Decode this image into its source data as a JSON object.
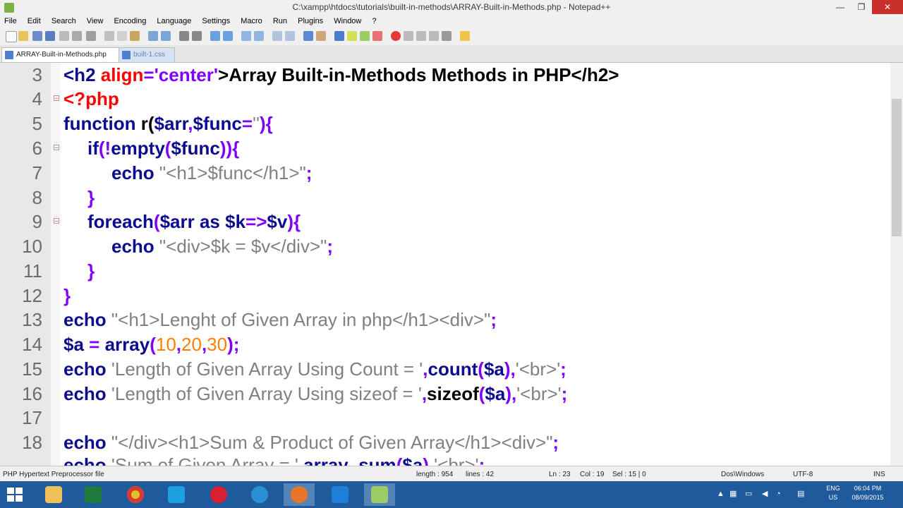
{
  "window": {
    "title": "C:\\xampp\\htdocs\\tutorials\\built-in-methods\\ARRAY-Built-in-Methods.php - Notepad++",
    "minimize": "—",
    "maximize": "❐",
    "close": "✕"
  },
  "menu": [
    "File",
    "Edit",
    "Search",
    "View",
    "Encoding",
    "Language",
    "Settings",
    "Macro",
    "Run",
    "Plugins",
    "Window",
    "?"
  ],
  "tabs": [
    {
      "label": "ARRAY-Built-in-Methods.php",
      "active": true,
      "close": "✕"
    },
    {
      "label": "built-1.css",
      "active": false,
      "close": "✕"
    }
  ],
  "editor": {
    "lines": [
      {
        "num": "3"
      },
      {
        "num": "4"
      },
      {
        "num": "5"
      },
      {
        "num": "6"
      },
      {
        "num": "7"
      },
      {
        "num": "8"
      },
      {
        "num": "9"
      },
      {
        "num": "10"
      },
      {
        "num": "11"
      },
      {
        "num": "12"
      },
      {
        "num": "13"
      },
      {
        "num": "14"
      },
      {
        "num": "15"
      },
      {
        "num": "16"
      },
      {
        "num": "17"
      },
      {
        "num": "18"
      }
    ],
    "code": {
      "l3": {
        "a": "<h2 ",
        "b": "align",
        "c": "=",
        "d": "'center'",
        "e": ">Array Built-in-Methods Methods in PHP</h2>"
      },
      "l4": {
        "a": "<?php"
      },
      "l5": {
        "a": "function ",
        "b": "r(",
        "c": "$arr",
        "d": ",",
        "e": "$func",
        "f": "=",
        "g": "''",
        "h": "){"
      },
      "l6": {
        "a": "if",
        "b": "(!",
        "c": "empty",
        "d": "(",
        "e": "$func",
        "f": ")){"
      },
      "l7": {
        "a": "echo ",
        "b": "\"<h1>$func</h1>\"",
        "c": ";"
      },
      "l8": {
        "a": "}"
      },
      "l9": {
        "a": "foreach",
        "b": "(",
        "c": "$arr",
        "d": " as ",
        "e": "$k",
        "f": "=>",
        "g": "$v",
        "h": "){"
      },
      "l10": {
        "a": "echo ",
        "b": "\"<div>$k = $v</div>\"",
        "c": ";"
      },
      "l11": {
        "a": "}"
      },
      "l12": {
        "a": "}"
      },
      "l13": {
        "a": "echo ",
        "b": "\"<h1>Lenght of Given Array in php</h1><div>\"",
        "c": ";"
      },
      "l14": {
        "a": "$a",
        "b": " = ",
        "c": "array",
        "d": "(",
        "e": "10",
        "f": ",",
        "g": "20",
        "h": ",",
        "i": "30",
        "j": ");"
      },
      "l15": {
        "a": "echo ",
        "b": "'Length of Given Array Using Count = '",
        "c": ",",
        "d": "count",
        "e": "(",
        "f": "$a",
        "g": "),",
        "h": "'<br>'",
        "i": ";"
      },
      "l16": {
        "a": "echo ",
        "b": "'Length of Given Array Using sizeof = '",
        "c": ",",
        "d": "sizeof",
        "e": "(",
        "f": "$a",
        "g": "),",
        "h": "'<br>'",
        "i": ";"
      },
      "l18": {
        "a": "echo ",
        "b": "\"</div><h1>Sum & Product of Given Array</h1><div>\"",
        "c": ";"
      },
      "l19": {
        "a": "echo ",
        "b": "'Sum of Given Array = '",
        "c": ",",
        "d": "array_sum",
        "e": "(",
        "f": "$a",
        "g": "),",
        "h": "'<br>'",
        "i": ";"
      }
    }
  },
  "status": {
    "filetype": "PHP Hypertext Preprocessor file",
    "length": "length : 954",
    "lines": "lines : 42",
    "ln": "Ln : 23",
    "col": "Col : 19",
    "sel": "Sel : 15 | 0",
    "eol": "Dos\\Windows",
    "encoding": "UTF-8",
    "mode": "INS"
  },
  "taskbar": {
    "lang": "ENG",
    "region": "US",
    "time": "06:04 PM",
    "date": "08/09/2015"
  },
  "colors": {
    "keyword": "#0c0c8e",
    "string": "#808080",
    "number": "#ff8000",
    "operator": "#8000ff",
    "php_tag": "#ff0000",
    "taskbar": "#1e5a9c"
  }
}
